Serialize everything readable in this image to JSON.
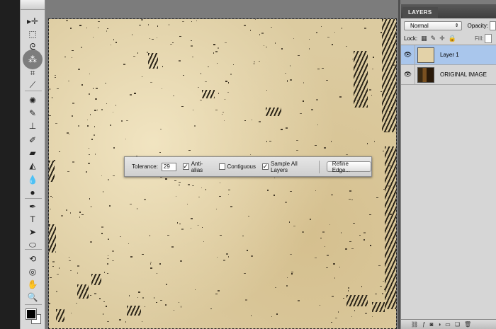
{
  "tools": [
    {
      "name": "move-tool-icon",
      "glyph": "▸✛"
    },
    {
      "name": "rectangular-marquee-icon",
      "glyph": "⬚"
    },
    {
      "name": "lasso-icon",
      "glyph": "ᘓ"
    },
    {
      "name": "magic-wand-icon",
      "glyph": "⁂"
    },
    {
      "name": "crop-icon",
      "glyph": "⌗"
    },
    {
      "name": "eyedropper-icon",
      "glyph": "⟋"
    },
    {
      "name": "spot-healing-icon",
      "glyph": "✺"
    },
    {
      "name": "brush-icon",
      "glyph": "✎"
    },
    {
      "name": "clone-stamp-icon",
      "glyph": "⊥"
    },
    {
      "name": "history-brush-icon",
      "glyph": "✐"
    },
    {
      "name": "eraser-icon",
      "glyph": "▰"
    },
    {
      "name": "paint-bucket-icon",
      "glyph": "◭"
    },
    {
      "name": "blur-icon",
      "glyph": "💧"
    },
    {
      "name": "dodge-icon",
      "glyph": "●"
    },
    {
      "name": "pen-icon",
      "glyph": "✒"
    },
    {
      "name": "type-icon",
      "glyph": "T"
    },
    {
      "name": "path-selection-icon",
      "glyph": "➤"
    },
    {
      "name": "shape-icon",
      "glyph": "⬭"
    },
    {
      "name": "3d-rotate-icon",
      "glyph": "⟲"
    },
    {
      "name": "3d-orbit-icon",
      "glyph": "◎"
    },
    {
      "name": "hand-icon",
      "glyph": "✋"
    },
    {
      "name": "zoom-icon",
      "glyph": "🔍"
    }
  ],
  "options_bar": {
    "tolerance_label": "Tolerance:",
    "tolerance_value": "29",
    "anti_alias_label": "Anti-alias",
    "anti_alias_checked": true,
    "contiguous_label": "Contiguous",
    "contiguous_checked": false,
    "sample_all_label": "Sample All Layers",
    "sample_all_checked": true,
    "refine_edge_label": "Refine Edge..."
  },
  "layers_panel": {
    "tab_label": "LAYERS",
    "blend_mode": "Normal",
    "opacity_label": "Opacity:",
    "lock_label": "Lock:",
    "fill_label": "Fill:",
    "layers": [
      {
        "name": "Layer 1",
        "selected": true
      },
      {
        "name": "ORIGINAL IMAGE",
        "selected": false
      }
    ]
  },
  "colors": {
    "selection_highlight": "#a9c6ec",
    "canvas_paper": "#dccba0",
    "foreground": "#000000",
    "background": "#ffffff"
  }
}
